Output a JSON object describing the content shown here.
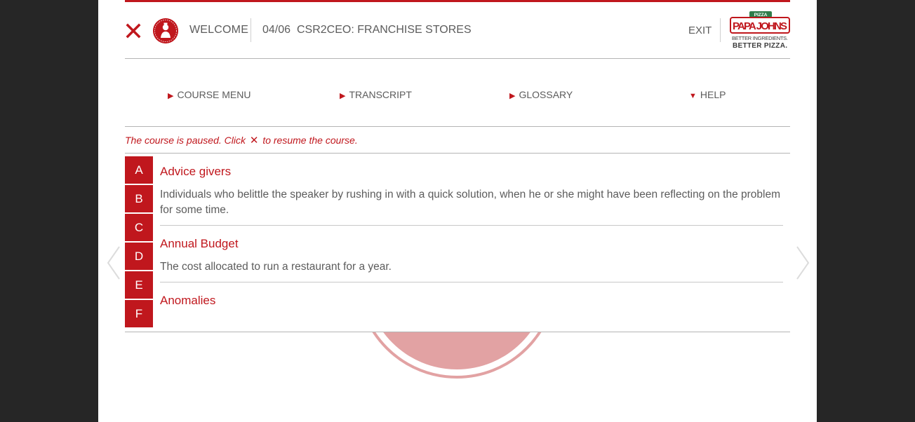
{
  "header": {
    "welcome": "WELCOME",
    "course_number": "04/06",
    "course_title": "CSR2CEO: FRANCHISE STORES",
    "exit_label": "EXIT",
    "logo": {
      "badge": "PIZZA",
      "brand": "PAPA JOHNS",
      "tagline_1": "BETTER INGREDIENTS.",
      "tagline_2": "BETTER PIZZA."
    }
  },
  "nav": {
    "items": [
      {
        "label": "COURSE MENU",
        "arrow": "▶"
      },
      {
        "label": "TRANSCRIPT",
        "arrow": "▶"
      },
      {
        "label": "GLOSSARY",
        "arrow": "▶"
      },
      {
        "label": "HELP",
        "arrow": "▼"
      }
    ]
  },
  "paused_message": {
    "before": "The course is paused. Click",
    "icon": "✕",
    "after": "to resume the course."
  },
  "glossary": {
    "letters": [
      "A",
      "B",
      "C",
      "D",
      "E",
      "F"
    ],
    "entries": [
      {
        "term": "Advice givers",
        "definition": "Individuals who belittle the speaker by rushing in with a quick solution, when he or she might have been reflecting on the problem for some time."
      },
      {
        "term": "Annual Budget",
        "definition": "The cost allocated to run a restaurant for a year."
      },
      {
        "term": "Anomalies",
        "definition": ""
      }
    ]
  },
  "colors": {
    "accent": "#c0171d",
    "text": "#5c5c5c",
    "pizza_fill": "#e2a2a3",
    "backdrop": "#262626"
  },
  "icons": {
    "close": "close-icon",
    "avatar": "papa-john-avatar-icon",
    "prev": "chevron-left-icon",
    "next": "chevron-right-icon"
  }
}
